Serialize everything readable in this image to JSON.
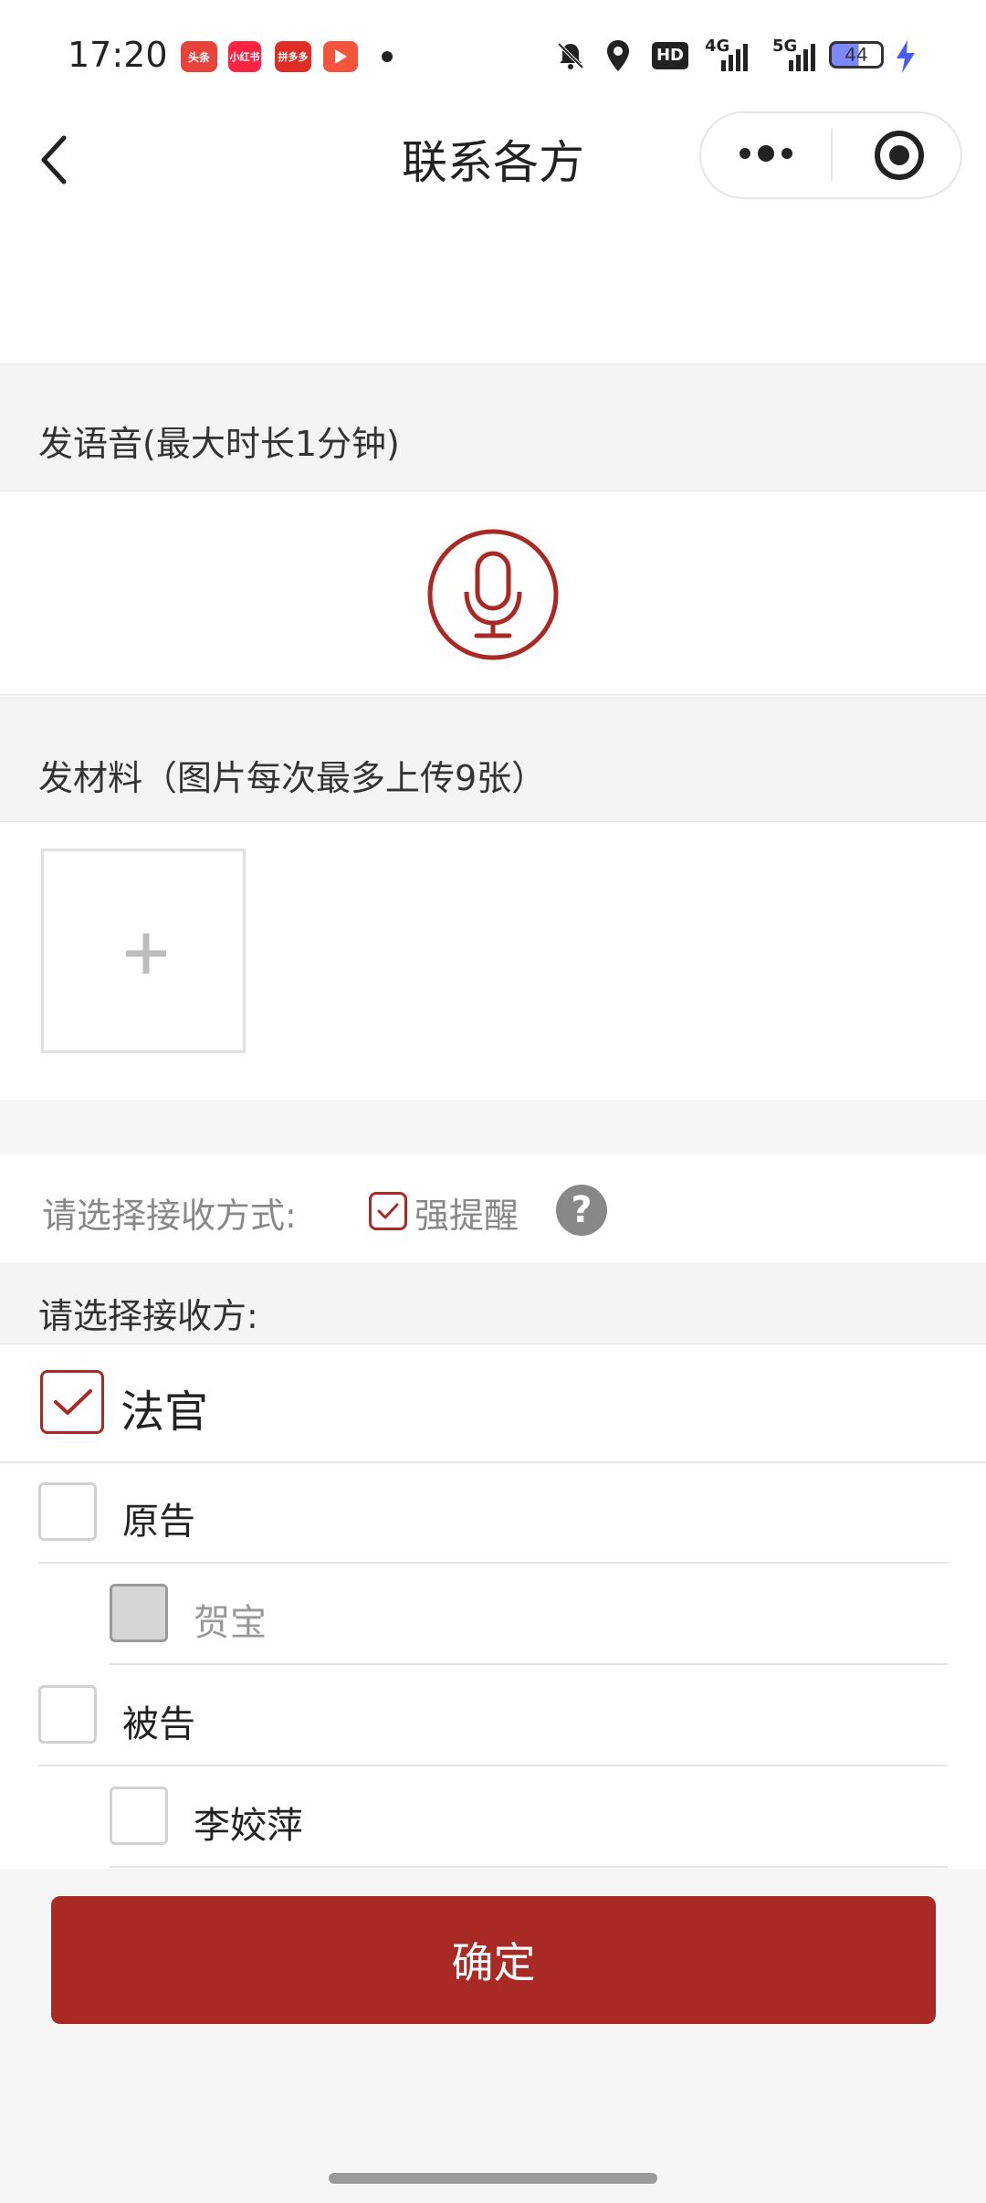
{
  "status_bar": {
    "time": "17:20",
    "app_icons": [
      "头条",
      "小红书",
      "拼多多",
      "video-app-icon"
    ],
    "indicators": [
      "silent-bell-icon",
      "location-icon",
      "HD",
      "4G",
      "5G"
    ],
    "battery": "44"
  },
  "nav": {
    "title": "联系各方"
  },
  "voice_section": {
    "title": "发语音(最大时长1分钟)"
  },
  "material_section": {
    "title": "发材料（图片每次最多上传9张）"
  },
  "receive_method": {
    "label": "请选择接收方式:",
    "option_label": "强提醒",
    "option_checked": true,
    "help": "?"
  },
  "receivers": {
    "label": "请选择接收方:",
    "items": [
      {
        "label": "法官",
        "checked": true,
        "level": 0
      },
      {
        "label": "原告",
        "checked": false,
        "level": 0
      },
      {
        "label": "贺宝",
        "checked": false,
        "disabled": true,
        "level": 1
      },
      {
        "label": "被告",
        "checked": false,
        "level": 0
      },
      {
        "label": "李姣萍",
        "checked": false,
        "level": 1
      }
    ]
  },
  "confirm_button": "确定",
  "colors": {
    "accent": "#a92a24",
    "background": "#f6f6f6"
  }
}
